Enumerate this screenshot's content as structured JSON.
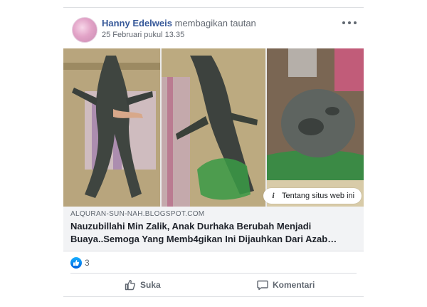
{
  "post": {
    "author": "Hanny Edelweis",
    "action": "membagikan tautan",
    "date": "25 Februari pukul 13.35"
  },
  "media": {
    "photos": [
      "photo-1",
      "photo-2",
      "photo-3"
    ],
    "tag_label": "Tentang situs web ini"
  },
  "link": {
    "domain": "ALQURAN-SUN-NAH.BLOGSPOT.COM",
    "headline": "Nauzubillahi Min Zalik, Anak Durhaka Berubah Menjadi\nBuaya..Semoga Yang Memb4gikan Ini Dijauhkan Dari Azab…"
  },
  "reactions": {
    "count": "3",
    "icon": "like-icon"
  },
  "actions": {
    "like_label": "Suka",
    "comment_label": "Komentari"
  },
  "colors": {
    "author_name": "#365899",
    "link_background": "#f2f3f5",
    "like_blue": "#1877f2"
  }
}
